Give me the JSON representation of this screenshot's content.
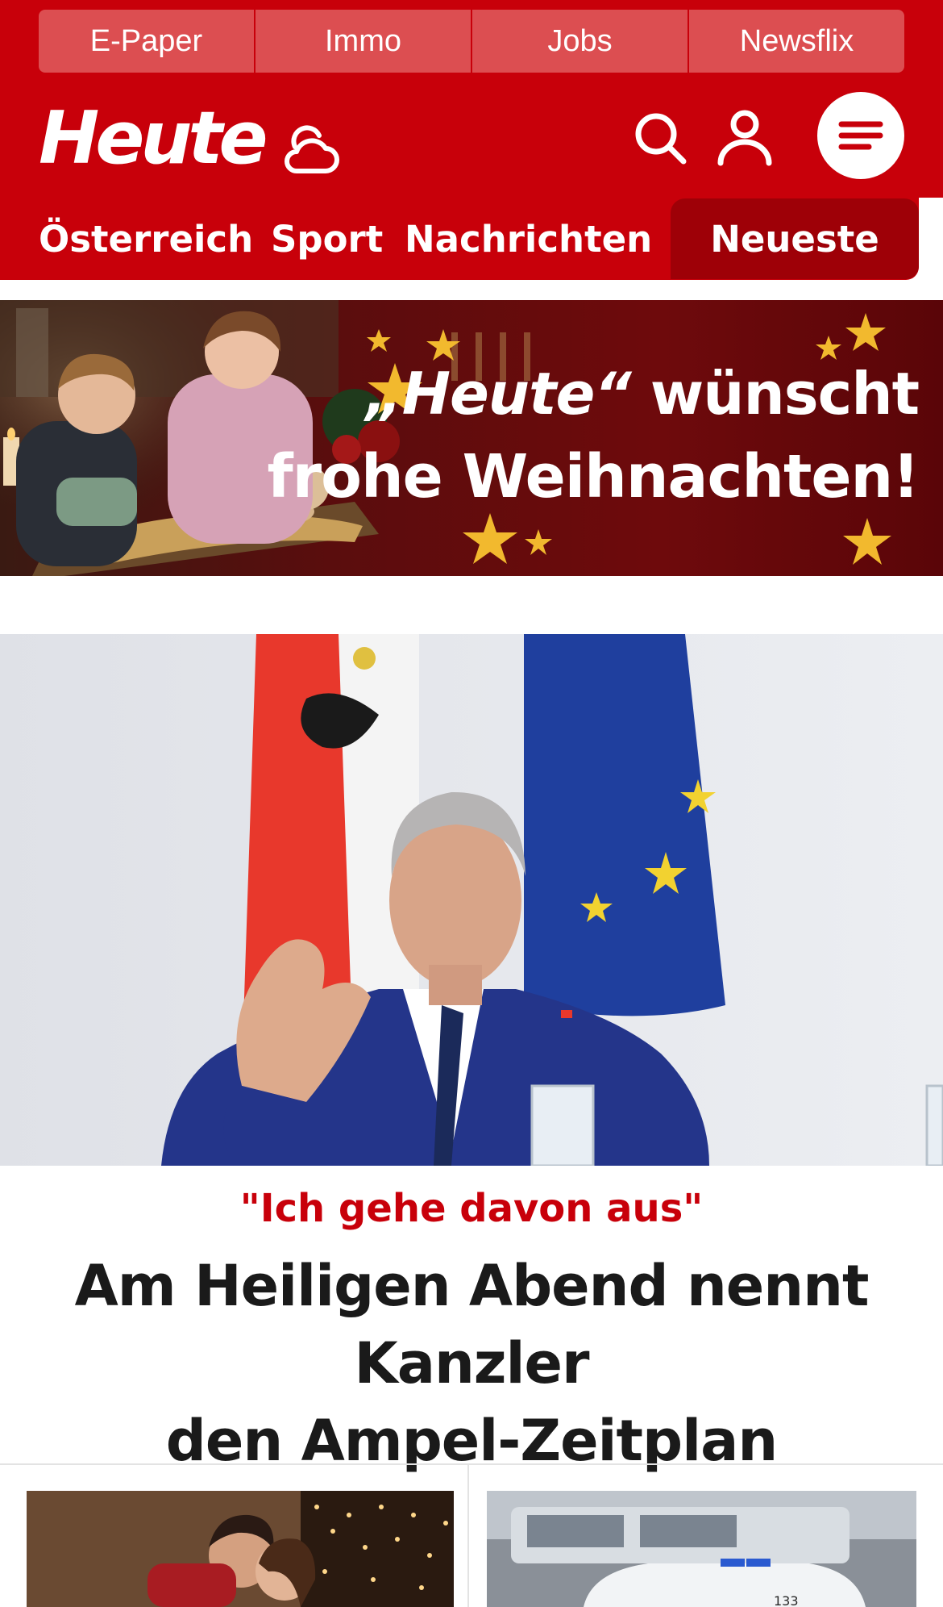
{
  "top_links": [
    {
      "label": "E-Paper"
    },
    {
      "label": "Immo"
    },
    {
      "label": "Jobs"
    },
    {
      "label": "Newsflix"
    }
  ],
  "header": {
    "logo_text": "Heute"
  },
  "nav": {
    "items": [
      {
        "label": "Österreich"
      },
      {
        "label": "Sport"
      },
      {
        "label": "Nachrichten"
      }
    ],
    "active_label": "Neueste"
  },
  "banner": {
    "line1_quoted": "„Heute“",
    "line1_rest": " wünscht",
    "line2": "frohe Weihnachten!"
  },
  "lead_article": {
    "kicker": "\"Ich gehe davon aus\"",
    "headline_line1": "Am Heiligen Abend nennt Kanzler",
    "headline_line2": "den Ampel-Zeitplan"
  },
  "teaser_photo_badge": "133",
  "colors": {
    "brand_red": "#c8000a",
    "top_link_bg": "#dc4e51",
    "active_tab_bg": "#9e0007",
    "headline_text": "#1a1a1a"
  },
  "icons": {
    "weather": "cloud-sun-icon",
    "search": "search-icon",
    "user": "user-icon",
    "menu": "menu-icon"
  }
}
